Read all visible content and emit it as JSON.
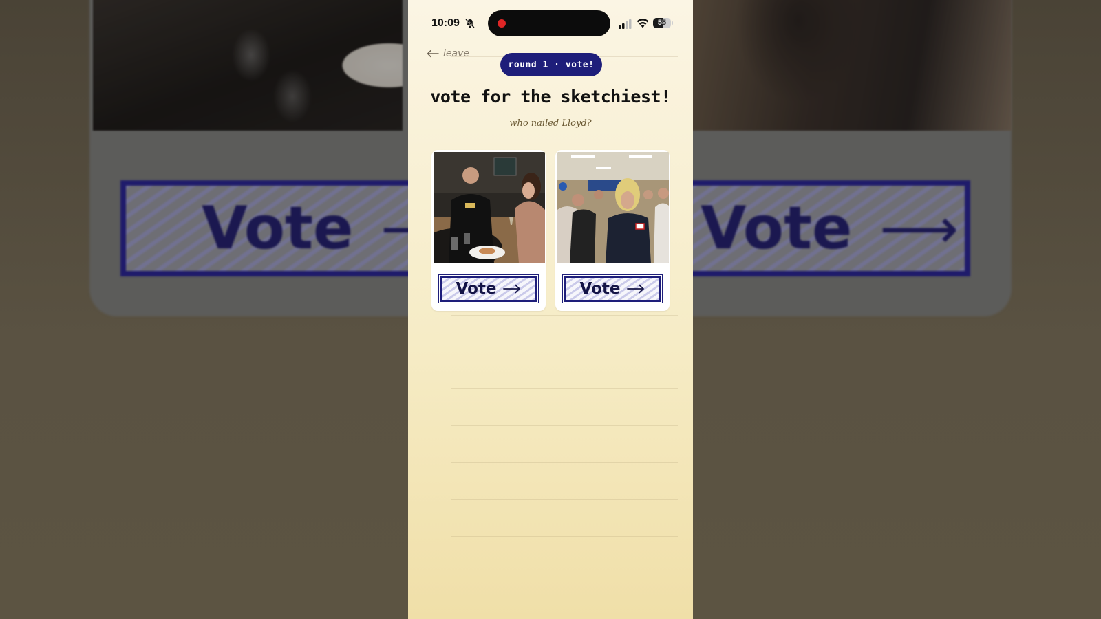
{
  "status_bar": {
    "time": "10:09",
    "battery_level": "55",
    "battery_percent": 55
  },
  "nav": {
    "leave_label": "leave"
  },
  "round_badge": "round 1 · vote!",
  "title": "vote for the sketchiest!",
  "subtitle": "who nailed Lloyd?",
  "cards": [
    {
      "photo_desc": "bald man in black jacket holding a card beside woman at dinner table",
      "vote_label": "Vote"
    },
    {
      "photo_desc": "man in blonde wig and suit with name tag at crowded reunion event",
      "vote_label": "Vote"
    }
  ],
  "background_copy": {
    "vote_label": "Vote"
  },
  "colors": {
    "accent_navy": "#1e1e7a",
    "paper_top": "#fbf5e4",
    "paper_bottom": "#f0dfa8",
    "record_dot": "#e02626"
  }
}
